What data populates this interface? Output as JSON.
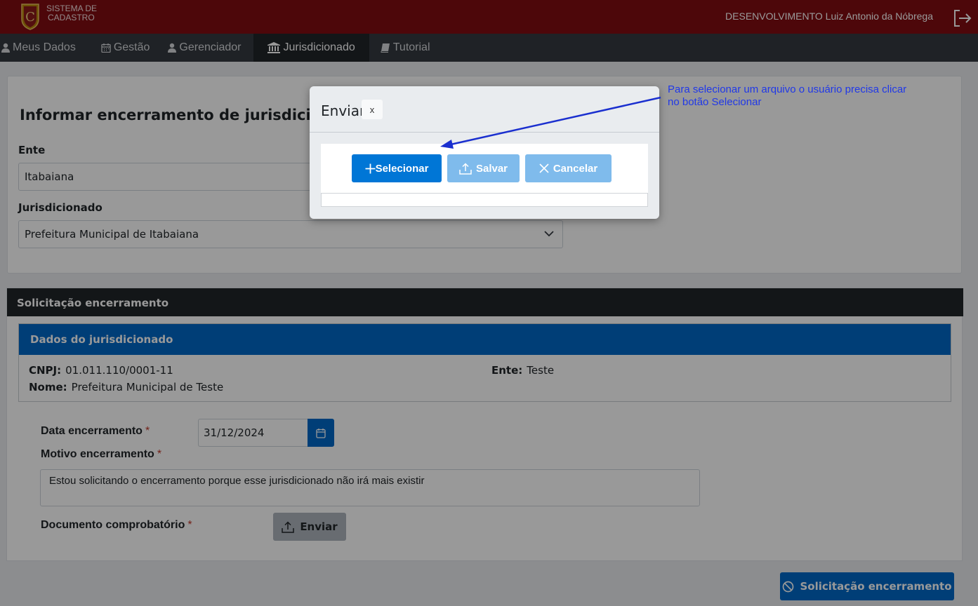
{
  "header": {
    "brand_line1": "SISTEMA DE",
    "brand_line2": "CADASTRO",
    "user_text": "DESENVOLVIMENTO Luiz Antonio da Nóbrega"
  },
  "nav": {
    "items": [
      {
        "label": "Meus Dados",
        "icon": "user-icon"
      },
      {
        "label": "Gestão",
        "icon": "calendar-icon"
      },
      {
        "label": "Gerenciador",
        "icon": "user-icon"
      },
      {
        "label": "Jurisdicionado",
        "icon": "bank-icon",
        "active": true
      },
      {
        "label": "Tutorial",
        "icon": "book-icon"
      }
    ]
  },
  "form": {
    "title": "Informar encerramento de jurisdicionado",
    "ente_label": "Ente",
    "ente_value": "Itabaiana",
    "jurisdicionado_label": "Jurisdicionado",
    "jurisdicionado_value": "Prefeitura Municipal de Itabaiana"
  },
  "solicitacao": {
    "header": "Solicitação encerramento",
    "dados_header": "Dados do jurisdicionado",
    "cnpj_label": "CNPJ:",
    "cnpj_value": "01.011.110/0001-11",
    "nome_label": "Nome:",
    "nome_value": "Prefeitura Municipal de Teste",
    "ente_label": "Ente:",
    "ente_value": "Teste",
    "data_label": "Data encerramento",
    "data_value": "31/12/2024",
    "motivo_label": "Motivo encerramento",
    "motivo_value": "Estou solicitando o encerramento porque esse jurisdicionado não irá mais existir",
    "doc_label": "Documento comprobatório",
    "required_mark": "*",
    "enviar_label": "Enviar",
    "submit_label": "Solicitação encerramento"
  },
  "dialog": {
    "title": "Enviar",
    "close_label": "x",
    "selecionar_label": "Selecionar",
    "salvar_label": "Salvar",
    "cancelar_label": "Cancelar"
  },
  "annotation": {
    "line1": "Para selecionar um arquivo o usuário precisa clicar",
    "line2": "no botão Selecionar"
  },
  "colors": {
    "header_bg": "#800d12",
    "nav_bg": "#343a40",
    "primary": "#0068c6",
    "annotation": "#2038e8"
  }
}
